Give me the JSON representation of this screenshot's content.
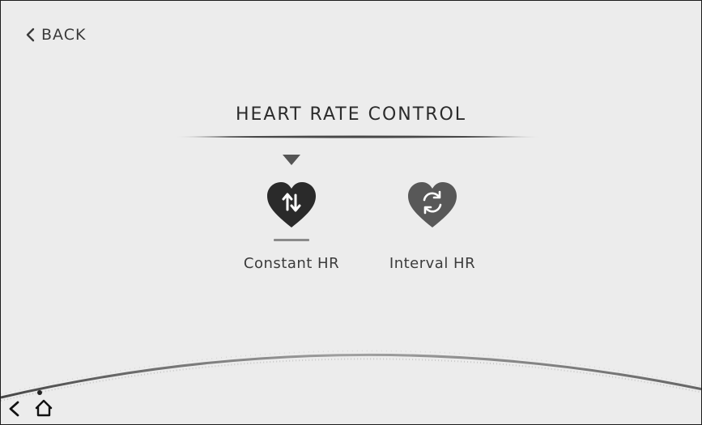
{
  "header": {
    "back_label": "BACK"
  },
  "title": "HEART RATE CONTROL",
  "options": [
    {
      "label": "Constant HR",
      "icon": "heart-up-down-arrows-icon",
      "selected": true
    },
    {
      "label": "Interval HR",
      "icon": "heart-cycle-icon",
      "selected": false
    }
  ],
  "bottom_nav": {
    "icons": [
      "chevron-left-icon",
      "home-icon"
    ]
  },
  "colors": {
    "background": "#ececec",
    "selected_heart": "#2a2a2a",
    "unselected_heart": "#585858",
    "text": "#3b3b3b",
    "underline": "#8a8a8a"
  }
}
